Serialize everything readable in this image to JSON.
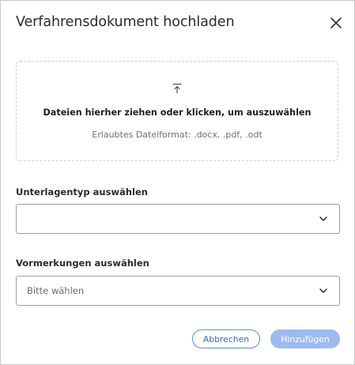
{
  "dialog": {
    "title": "Verfahrensdokument hochladen",
    "close_icon": "close-icon"
  },
  "dropzone": {
    "icon": "upload-icon",
    "instruction": "Dateien hierher ziehen oder klicken, um auszuwählen",
    "allowed_formats": "Erlaubtes Dateiformat: .docx, .pdf, .odt"
  },
  "document_type": {
    "label": "Unterlagentyp auswählen",
    "value": "",
    "icon": "chevron-down-icon"
  },
  "reservations": {
    "label": "Vormerkungen auswählen",
    "placeholder": "Bitte wählen",
    "icon": "chevron-down-icon"
  },
  "actions": {
    "cancel_label": "Abbrechen",
    "add_label": "Hinzufügen"
  },
  "colors": {
    "primary": "#2f6fc5",
    "primary_disabled": "#9dbaf0",
    "text": "#2b2b2b",
    "muted": "#6e6e6e",
    "border": "#9aa0a6",
    "dropzone_border": "#c9ced6"
  }
}
